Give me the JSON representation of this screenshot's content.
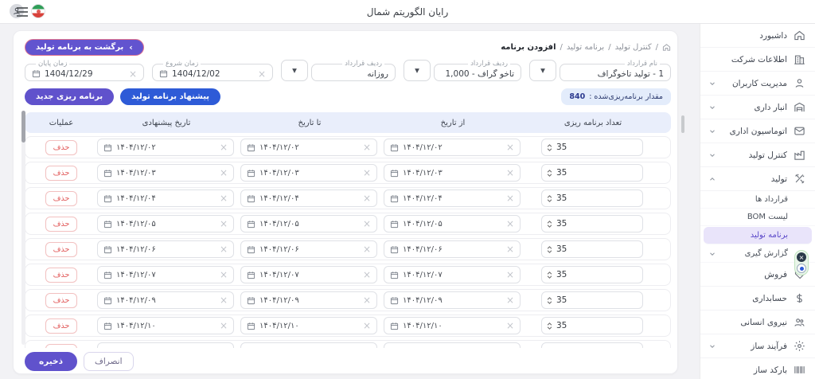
{
  "topbar": {
    "title": "رایان الگوریتم شمال"
  },
  "sidebar": {
    "items": [
      {
        "label": "داشبورد",
        "icon": "home-icon"
      },
      {
        "label": "اطلاعات شرکت",
        "icon": "building-icon"
      },
      {
        "label": "مدیریت کاربران",
        "icon": "user-icon",
        "chevron": "chevron-down-icon"
      },
      {
        "label": "انبار داری",
        "icon": "warehouse-icon",
        "chevron": "chevron-down-icon"
      },
      {
        "label": "اتوماسیون اداری",
        "icon": "mail-icon",
        "chevron": "chevron-down-icon"
      },
      {
        "label": "کنترل تولید",
        "icon": "factory-icon",
        "chevron": "chevron-down-icon"
      },
      {
        "label": "تولید",
        "icon": "tools-icon",
        "chevron": "chevron-up-icon"
      },
      {
        "label": "قرارداد ها",
        "sub": true
      },
      {
        "label": "لیست BOM",
        "sub": true
      },
      {
        "label": "برنامه تولید",
        "sub": true,
        "active": true
      },
      {
        "label": "گزارش گیری",
        "sub": true,
        "chevron": "chevron-down-icon"
      },
      {
        "label": "فروش",
        "icon": "tag-icon"
      },
      {
        "label": "حسابداری",
        "icon": "dollar-icon"
      },
      {
        "label": "نیروی انسانی",
        "icon": "people-icon"
      },
      {
        "label": "فرآیند ساز",
        "icon": "process-gear-icon",
        "chevron": "chevron-down-icon"
      },
      {
        "label": "بارکد ساز",
        "icon": "barcode-icon"
      }
    ]
  },
  "main": {
    "back_button": "برگشت به برنامه تولید",
    "back_chevron": "›",
    "breadcrumb": {
      "items": [
        "کنترل تولید",
        "برنامه تولید"
      ],
      "current": "افزودن برنامه",
      "separator": "/"
    },
    "filters": {
      "contract_name": {
        "label": "نام قرارداد",
        "value": "1 - تولید تاخوگراف"
      },
      "contract_row": {
        "label": "ردیف قرارداد",
        "value": "تاخو گراف - 1,000"
      },
      "period": {
        "label": "ردیف قرارداد",
        "value": "روزانه"
      },
      "start": {
        "label": "زمان شروع",
        "value": "1404/12/02"
      },
      "end": {
        "label": "زمان پایان",
        "value": "1404/12/29"
      }
    },
    "planned_badge": {
      "label": "مقدار برنامه‌ریزی‌شده :",
      "value": "840"
    },
    "actions": {
      "suggest": "پیشنهاد برنامه تولید",
      "new_plan": "برنامه ریزی جدید"
    },
    "table": {
      "headers": [
        "تعداد برنامه ریزی",
        "از تاریخ",
        "تا تاریخ",
        "تاریخ پیشنهادی",
        "عملیات"
      ],
      "delete_label": "حذف",
      "rows": [
        {
          "count": "35",
          "from": "۱۴۰۴/۱۲/۰۲",
          "to": "۱۴۰۴/۱۲/۰۲",
          "suggested": "۱۴۰۴/۱۲/۰۲"
        },
        {
          "count": "35",
          "from": "۱۴۰۴/۱۲/۰۳",
          "to": "۱۴۰۴/۱۲/۰۳",
          "suggested": "۱۴۰۴/۱۲/۰۳"
        },
        {
          "count": "35",
          "from": "۱۴۰۴/۱۲/۰۴",
          "to": "۱۴۰۴/۱۲/۰۴",
          "suggested": "۱۴۰۴/۱۲/۰۴"
        },
        {
          "count": "35",
          "from": "۱۴۰۴/۱۲/۰۵",
          "to": "۱۴۰۴/۱۲/۰۵",
          "suggested": "۱۴۰۴/۱۲/۰۵"
        },
        {
          "count": "35",
          "from": "۱۴۰۴/۱۲/۰۶",
          "to": "۱۴۰۴/۱۲/۰۶",
          "suggested": "۱۴۰۴/۱۲/۰۶"
        },
        {
          "count": "35",
          "from": "۱۴۰۴/۱۲/۰۷",
          "to": "۱۴۰۴/۱۲/۰۷",
          "suggested": "۱۴۰۴/۱۲/۰۷"
        },
        {
          "count": "35",
          "from": "۱۴۰۴/۱۲/۰۹",
          "to": "۱۴۰۴/۱۲/۰۹",
          "suggested": "۱۴۰۴/۱۲/۰۹"
        },
        {
          "count": "35",
          "from": "۱۴۰۴/۱۲/۱۰",
          "to": "۱۴۰۴/۱۲/۱۰",
          "suggested": "۱۴۰۴/۱۲/۱۰"
        },
        {
          "count": "",
          "from": "",
          "to": "",
          "suggested": "",
          "partial": true
        }
      ]
    },
    "footer": {
      "save": "ذخیره",
      "cancel": "انصراف"
    }
  },
  "colors": {
    "accent_violet": "#6052cc",
    "accent_blue": "#2e5bd7",
    "active_item_bg": "#e9e4fa",
    "table_header_bg": "#e9eefb",
    "badge_bg": "#e3ecfb",
    "delete_red": "#e25c5c"
  }
}
